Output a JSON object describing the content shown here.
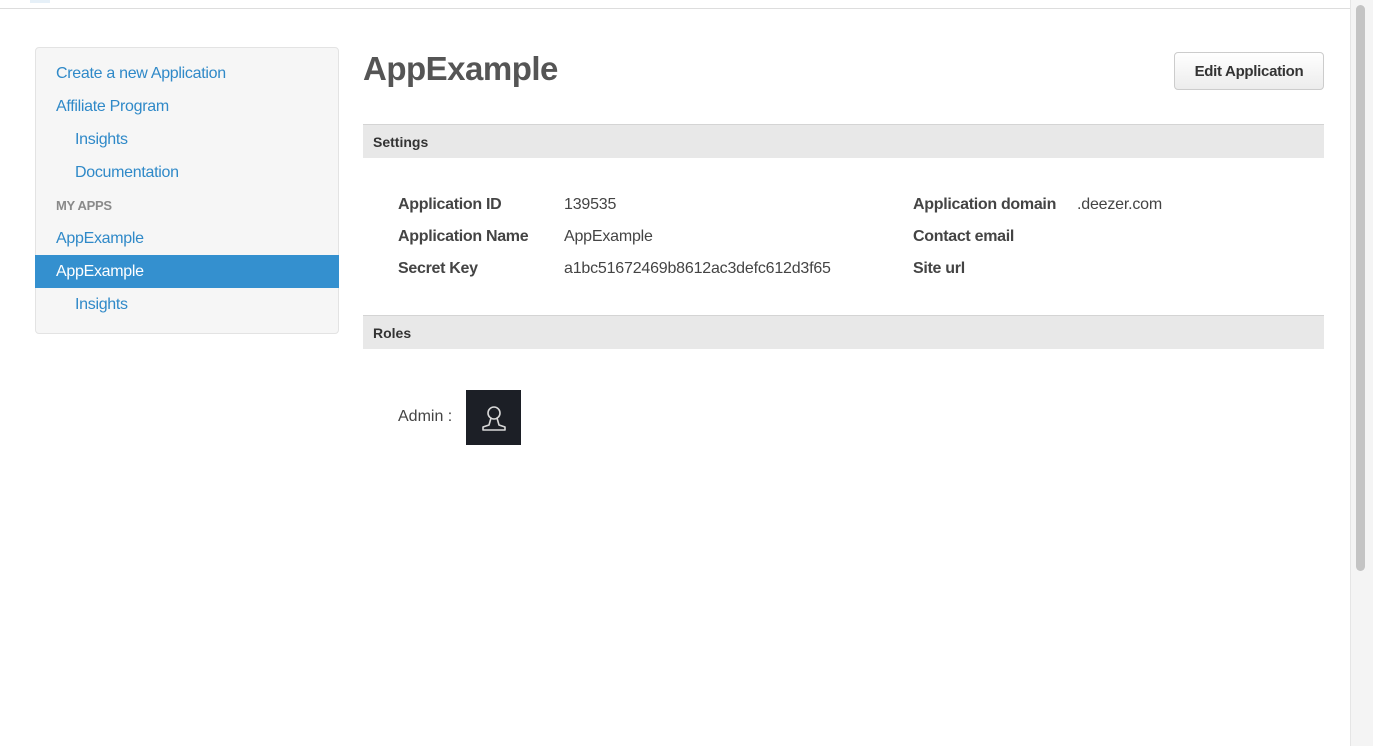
{
  "sidebar": {
    "items": [
      {
        "label": "Create a new Application"
      },
      {
        "label": "Affiliate Program"
      },
      {
        "label": "Insights"
      },
      {
        "label": "Documentation"
      },
      {
        "label": "MY APPS"
      },
      {
        "label": "AppExample"
      },
      {
        "label": "AppExample"
      },
      {
        "label": "Insights"
      }
    ]
  },
  "page": {
    "title": "AppExample",
    "edit_button": "Edit Application"
  },
  "settings": {
    "heading": "Settings",
    "application_id_label": "Application ID",
    "application_id_value": "139535",
    "application_name_label": "Application Name",
    "application_name_value": "AppExample",
    "secret_key_label": "Secret Key",
    "secret_key_value": "a1bc51672469b8612ac3defc612d3f65",
    "application_domain_label": "Application domain",
    "application_domain_value": ".deezer.com",
    "contact_email_label": "Contact email",
    "site_url_label": "Site url"
  },
  "roles": {
    "heading": "Roles",
    "admin_label": "Admin :",
    "avatar_icon": "user-silhouette-icon"
  },
  "colors": {
    "link": "#2f89c8",
    "active_bg": "#3490cf",
    "section_bg": "#e8e8e8"
  }
}
